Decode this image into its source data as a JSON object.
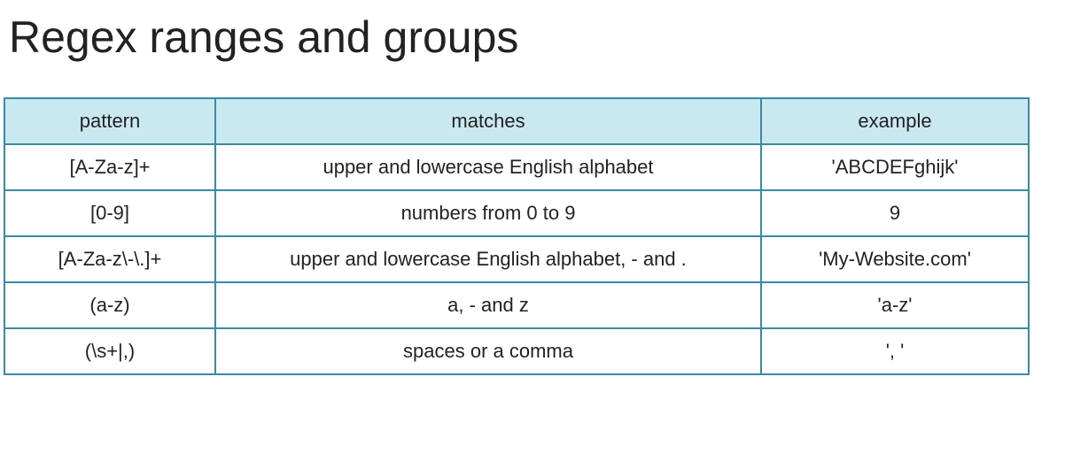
{
  "page": {
    "title": "Regex ranges and groups"
  },
  "table": {
    "headers": [
      "pattern",
      "matches",
      "example"
    ],
    "rows": [
      {
        "pattern": "[A-Za-z]+",
        "matches": "upper and lowercase English alphabet",
        "example": "'ABCDEFghijk'"
      },
      {
        "pattern": "[0-9]",
        "matches": "numbers from 0 to 9",
        "example": "9"
      },
      {
        "pattern": "[A-Za-z\\-\\.]+",
        "matches": "upper and lowercase English alphabet, - and .",
        "example": "'My-Website.com'"
      },
      {
        "pattern": "(a-z)",
        "matches": "a, - and z",
        "example": "'a-z'"
      },
      {
        "pattern": "(\\s+|,)",
        "matches": "spaces or a comma",
        "example": "', '"
      }
    ]
  },
  "colors": {
    "header_background": "#c9e8f0",
    "border": "#3a8aa6",
    "text": "#222222"
  }
}
